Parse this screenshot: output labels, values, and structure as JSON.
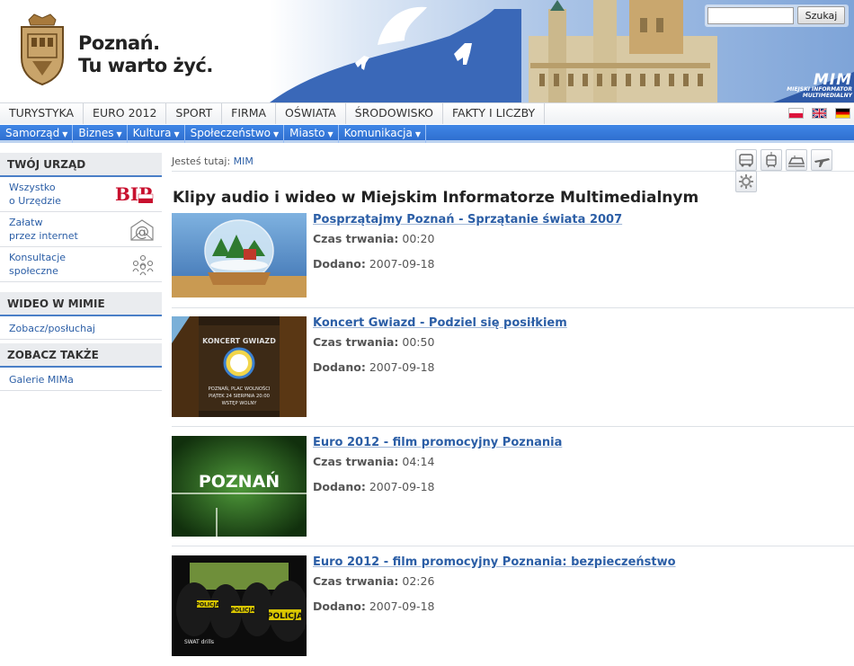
{
  "header": {
    "logo_line1": "Poznań.",
    "logo_line2": "Tu warto żyć.",
    "search_placeholder": "",
    "search_button": "Szukaj",
    "mim_title": "MIM",
    "mim_subtitle_1": "MIEJSKI INFORMATOR",
    "mim_subtitle_2": "MULTIMEDIALNY"
  },
  "top_nav": [
    "TURYSTYKA",
    "EURO 2012",
    "SPORT",
    "FIRMA",
    "OŚWIATA",
    "ŚRODOWISKO",
    "FAKTY I LICZBY"
  ],
  "languages": [
    {
      "name": "flag-pl-icon"
    },
    {
      "name": "flag-uk-icon"
    },
    {
      "name": "flag-de-icon"
    }
  ],
  "blue_nav": [
    "Samorząd",
    "Biznes",
    "Kultura",
    "Społeczeństwo",
    "Miasto",
    "Komunikacja"
  ],
  "sidebar": {
    "section1": {
      "title": "TWÓJ URZĄD",
      "items": [
        {
          "line1": "Wszystko",
          "line2": "o Urzędzie",
          "icon": "bip-icon",
          "icon_text": "BIP"
        },
        {
          "line1": "Załatw",
          "line2": "przez internet",
          "icon": "at-mail-icon",
          "icon_text": "@"
        },
        {
          "line1": "Konsultacje",
          "line2": "społeczne",
          "icon": "people-icon",
          "icon_text": ""
        }
      ]
    },
    "section2": {
      "title": "WIDEO W MIMIE",
      "items": [
        "Zobacz/posłuchaj"
      ]
    },
    "section3": {
      "title": "ZOBACZ TAKŻE",
      "items": [
        "Galerie MIMa"
      ]
    }
  },
  "breadcrumb": {
    "prefix": "Jesteś tutaj:",
    "link": "MIM"
  },
  "tool_icons": [
    "bus-icon",
    "tram-icon",
    "train-icon",
    "plane-icon",
    "settings-icon"
  ],
  "main": {
    "title": "Klipy audio i wideo w Miejskim Informatorze Multimedialnym",
    "duration_label": "Czas trwania:",
    "added_label": "Dodano:",
    "clips": [
      {
        "title": "Posprzątajmy Poznań - Sprzątanie świata 2007",
        "duration": "00:20",
        "added": "2007-09-18",
        "thumb": "snow-globe"
      },
      {
        "title": "Koncert Gwiazd - Podziel się posiłkiem",
        "duration": "00:50",
        "added": "2007-09-18",
        "thumb": "concert-poster",
        "thumb_text": [
          "KONCERT GWIAZD",
          "POZNAŃ, PLAC WOLNOŚCI",
          "PIĄTEK 24 SIERPNIA 20:00",
          "WSTĘP WOLNY"
        ]
      },
      {
        "title": "Euro 2012 - film promocyjny Poznania",
        "duration": "04:14",
        "added": "2007-09-18",
        "thumb": "pitch",
        "thumb_text": "POZNAŃ"
      },
      {
        "title": "Euro 2012 - film promocyjny Poznania: bezpieczeństwo",
        "duration": "02:26",
        "added": "2007-09-18",
        "thumb": "police",
        "thumb_text": [
          "POLICJA",
          "POLICJA",
          "POLICJA",
          "SWAT drills"
        ]
      }
    ]
  },
  "colors": {
    "link": "#2b5ea6",
    "blue_nav": "#3a7de0",
    "section_border": "#4a7fc7"
  }
}
